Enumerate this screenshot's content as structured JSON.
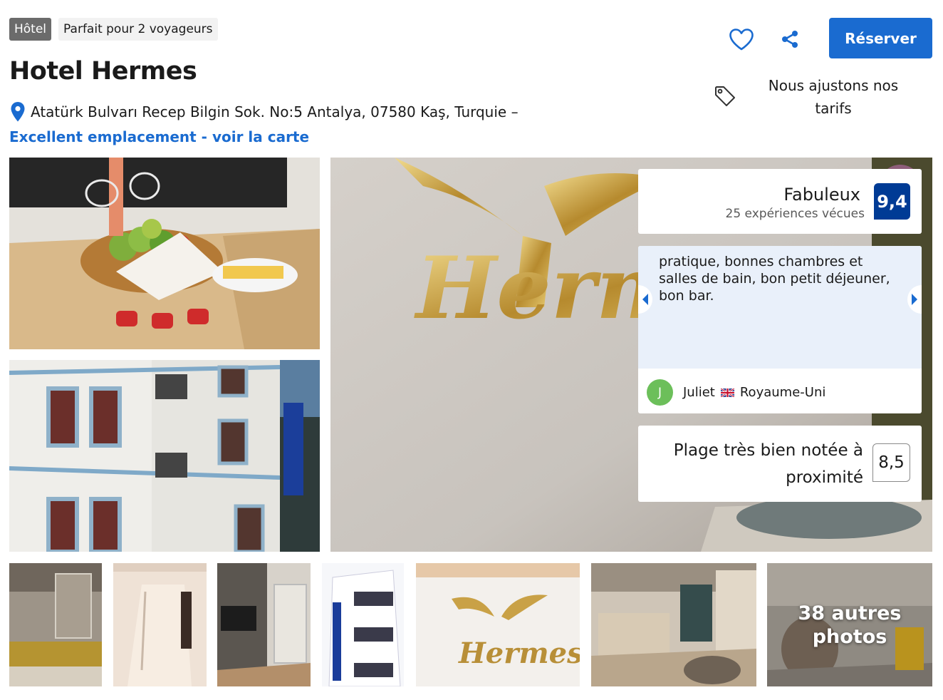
{
  "header": {
    "type_badge": "Hôtel",
    "info_badge": "Parfait pour 2 voyageurs",
    "title": "Hotel Hermes",
    "address": "Atatürk Bulvarı Recep Bilgin Sok. No:5 Antalya, 07580 Kaş, Turquie –",
    "map_link": "Excellent emplacement - voir la carte"
  },
  "actions": {
    "favorite_icon": "heart-icon",
    "share_icon": "share-icon",
    "reserve_label": "Réserver",
    "price_match_icon": "price-tag-icon",
    "price_match_text": "Nous ajustons nos tarifs",
    "accent_color": "#1a6bd0"
  },
  "rating": {
    "label": "Fabuleux",
    "reviews": "25 expériences vécues",
    "score": "9,4",
    "score_color": "#003b95"
  },
  "review": {
    "text": "pratique, bonnes chambres et salles de bain, bon petit déjeuner, bon bar.",
    "avatar_initial": "J",
    "name": "Juliet",
    "country": "Royaume-Uni",
    "flag_icon": "uk-flag-icon"
  },
  "beach": {
    "label": "Plage très bien notée à proximité",
    "score": "8,5"
  },
  "gallery": {
    "more_photos": "38 autres photos",
    "photos": [
      "fruit-basket-photo",
      "hotel-facade-photo",
      "hermes-logo-wall-photo",
      "lounge-photo",
      "hallway-photo",
      "room-tv-photo",
      "building-exterior-photo",
      "hermes-sign-photo",
      "reception-photo",
      "lobby-chair-photo"
    ]
  }
}
